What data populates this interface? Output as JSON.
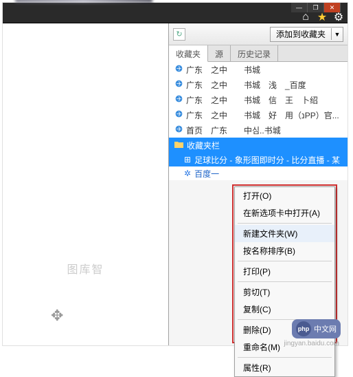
{
  "window": {
    "min": "—",
    "max": "❐",
    "close": "✕"
  },
  "topIcons": {
    "home": "⌂",
    "star": "★",
    "gear": "⚙"
  },
  "toolbar": {
    "refresh": "↻",
    "addFav": "添加到收藏夹",
    "drop": "▼"
  },
  "tabs": {
    "fav": "收藏夹",
    "feed": "源",
    "history": "历史记录"
  },
  "favItems": [
    "广东　之中　　书城",
    "广东　之中　　书城　浅　_百度",
    "广东　之中　　书城　信　王　卜绍",
    "广东　之中　　书城　好　用（נPP）官...",
    "首页　广东　　中심..书城"
  ],
  "folder": {
    "label": "收藏夹栏",
    "subSel": "足球比分 - 象形图即时分 - 比分直播 - 某",
    "subNorm": "百度一"
  },
  "ctx": {
    "open": "打开(O)",
    "newtab": "在新选项卡中打开(A)",
    "newfolder": "新建文件夹(W)",
    "sortname": "按名称排序(B)",
    "print": "打印(P)",
    "cut": "剪切(T)",
    "copy": "复制(C)",
    "delete": "删除(D)",
    "rename": "重命名(M)",
    "props": "属性(R)"
  },
  "watermark": "图库智",
  "badge": {
    "p": "php",
    "txt": "中文网"
  },
  "urlMark": "jingyan.baidu.com"
}
